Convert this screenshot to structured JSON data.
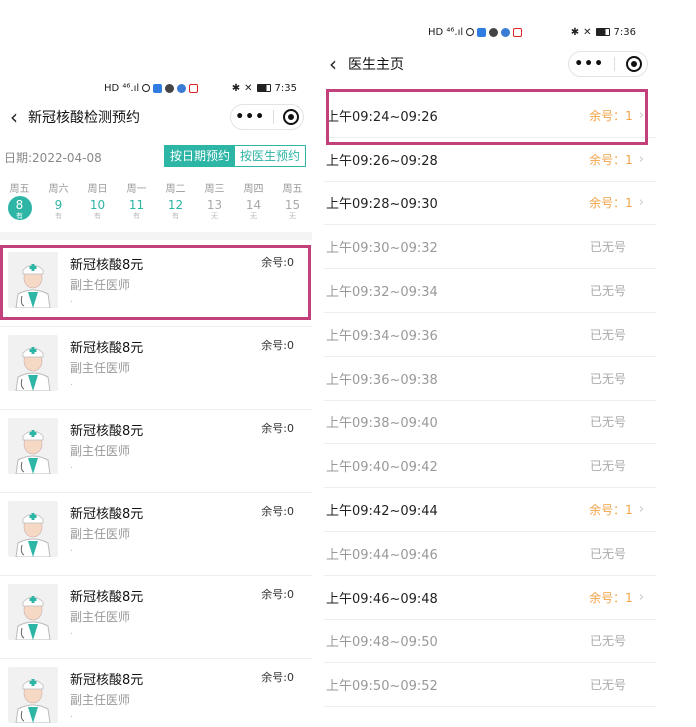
{
  "left": {
    "status": {
      "time": "7:35",
      "signal_text": "HD ⁴⁶.ıl"
    },
    "header": {
      "title": "新冠核酸检测预约",
      "back_icon": "chevron-left-icon",
      "more_dots": "•••"
    },
    "date_label": "日期:2022-04-08",
    "buttons": {
      "by_date": "按日期预约",
      "by_doctor": "按医生预约"
    },
    "week": [
      {
        "wd": "周五",
        "d": "8",
        "s": "有",
        "sel": true
      },
      {
        "wd": "周六",
        "d": "9",
        "s": "有"
      },
      {
        "wd": "周日",
        "d": "10",
        "s": "有"
      },
      {
        "wd": "周一",
        "d": "11",
        "s": "有"
      },
      {
        "wd": "周二",
        "d": "12",
        "s": "有"
      },
      {
        "wd": "周三",
        "d": "13",
        "s": "无"
      },
      {
        "wd": "周四",
        "d": "14",
        "s": "无"
      },
      {
        "wd": "周五",
        "d": "15",
        "s": "无"
      }
    ],
    "doctors": [
      {
        "name": "新冠核酸8元",
        "title": "副主任医师",
        "remain": "余号:0"
      },
      {
        "name": "新冠核酸8元",
        "title": "副主任医师",
        "remain": "余号:0"
      },
      {
        "name": "新冠核酸8元",
        "title": "副主任医师",
        "remain": "余号:0"
      },
      {
        "name": "新冠核酸8元",
        "title": "副主任医师",
        "remain": "余号:0"
      },
      {
        "name": "新冠核酸8元",
        "title": "副主任医师",
        "remain": "余号:0"
      },
      {
        "name": "新冠核酸8元",
        "title": "副主任医师",
        "remain": "余号:0"
      }
    ]
  },
  "right": {
    "status": {
      "time": "7:36",
      "signal_text": "HD ⁴⁶.ıl"
    },
    "header": {
      "title": "医生主页",
      "back_icon": "chevron-left-icon",
      "more_dots": "•••"
    },
    "slots": [
      {
        "time": "上午09:24~09:26",
        "status": "余号：1",
        "available": true
      },
      {
        "time": "上午09:26~09:28",
        "status": "余号：1",
        "available": true
      },
      {
        "time": "上午09:28~09:30",
        "status": "余号：1",
        "available": true
      },
      {
        "time": "上午09:30~09:32",
        "status": "已无号",
        "available": false
      },
      {
        "time": "上午09:32~09:34",
        "status": "已无号",
        "available": false
      },
      {
        "time": "上午09:34~09:36",
        "status": "已无号",
        "available": false
      },
      {
        "time": "上午09:36~09:38",
        "status": "已无号",
        "available": false
      },
      {
        "time": "上午09:38~09:40",
        "status": "已无号",
        "available": false
      },
      {
        "time": "上午09:40~09:42",
        "status": "已无号",
        "available": false
      },
      {
        "time": "上午09:42~09:44",
        "status": "余号：1",
        "available": true
      },
      {
        "time": "上午09:44~09:46",
        "status": "已无号",
        "available": false
      },
      {
        "time": "上午09:46~09:48",
        "status": "余号：1",
        "available": true
      },
      {
        "time": "上午09:48~09:50",
        "status": "已无号",
        "available": false
      },
      {
        "time": "上午09:50~09:52",
        "status": "已无号",
        "available": false
      }
    ]
  },
  "colors": {
    "accent": "#2db5a5",
    "highlight": "#c2417a",
    "available": "#f2a34a"
  }
}
